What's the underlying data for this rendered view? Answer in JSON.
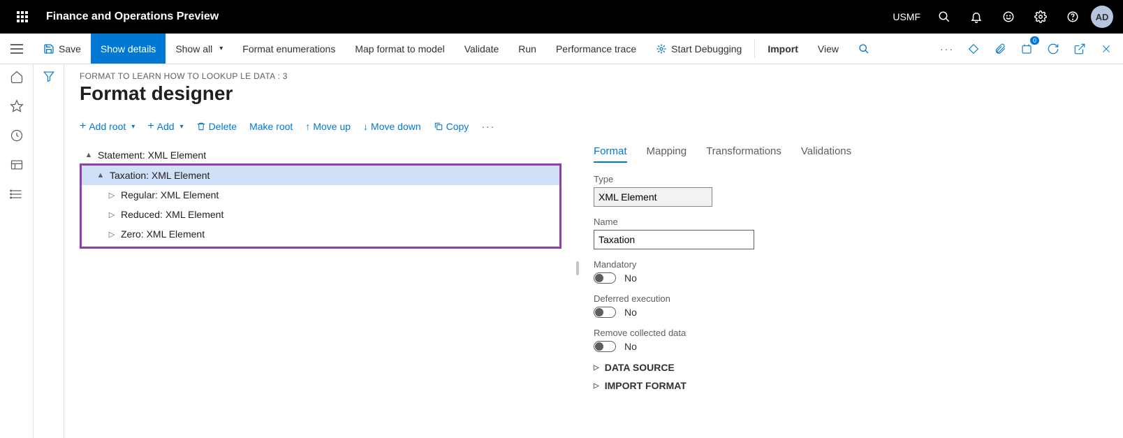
{
  "topbar": {
    "app_title": "Finance and Operations Preview",
    "company": "USMF",
    "avatar": "AD"
  },
  "cmdbar": {
    "save": "Save",
    "show_details": "Show details",
    "show_all": "Show all",
    "format_enum": "Format enumerations",
    "map_format": "Map format to model",
    "validate": "Validate",
    "run": "Run",
    "perf_trace": "Performance trace",
    "start_debug": "Start Debugging",
    "import": "Import",
    "view": "View",
    "notif_count": "0"
  },
  "page": {
    "breadcrumb": "FORMAT TO LEARN HOW TO LOOKUP LE DATA : 3",
    "title": "Format designer"
  },
  "toolbar2": {
    "add_root": "Add root",
    "add": "Add",
    "delete": "Delete",
    "make_root": "Make root",
    "move_up": "Move up",
    "move_down": "Move down",
    "copy": "Copy"
  },
  "tree": {
    "n0": "Statement: XML Element",
    "n1": "Taxation: XML Element",
    "n2": "Regular: XML Element",
    "n3": "Reduced: XML Element",
    "n4": "Zero: XML Element"
  },
  "tabs": {
    "format": "Format",
    "mapping": "Mapping",
    "transformations": "Transformations",
    "validations": "Validations"
  },
  "form": {
    "type_label": "Type",
    "type_value": "XML Element",
    "name_label": "Name",
    "name_value": "Taxation",
    "mandatory_label": "Mandatory",
    "mandatory_value": "No",
    "deferred_label": "Deferred execution",
    "deferred_value": "No",
    "remove_label": "Remove collected data",
    "remove_value": "No",
    "data_source": "DATA SOURCE",
    "import_format": "IMPORT FORMAT"
  }
}
